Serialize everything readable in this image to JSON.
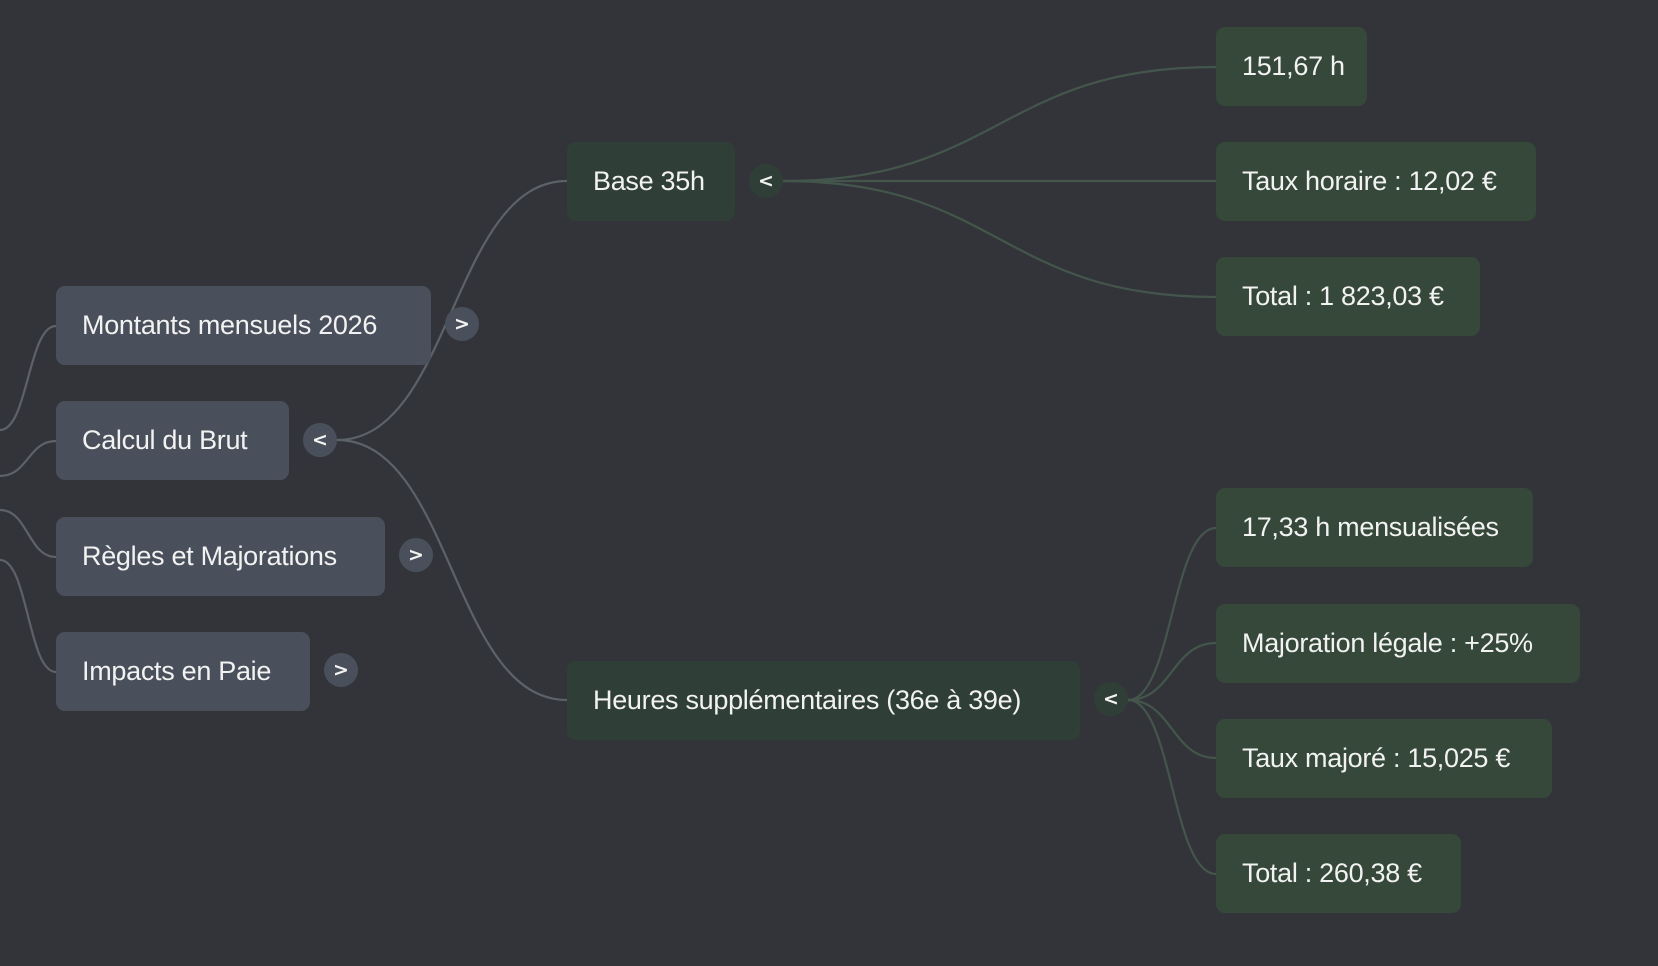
{
  "colors": {
    "background": "#32343a",
    "level1_node": "#4a505b",
    "level2_node": "#2f3f37",
    "level3_node": "#354839",
    "edge_gray": "#5d6269",
    "edge_green": "#44564b",
    "text": "#f2f2f2"
  },
  "toggle_icons": {
    "collapsed": ">",
    "expanded": "<"
  },
  "mindmap": {
    "branches": [
      {
        "label": "Montants mensuels 2026",
        "toggle": ">",
        "state": "collapsed"
      },
      {
        "label": "Calcul du Brut",
        "toggle": "<",
        "state": "expanded",
        "children": [
          {
            "label": "Base 35h",
            "toggle": "<",
            "state": "expanded",
            "children": [
              {
                "label": "151,67 h"
              },
              {
                "label": "Taux horaire : 12,02 €"
              },
              {
                "label": "Total : 1 823,03 €"
              }
            ]
          },
          {
            "label": "Heures supplémentaires (36e à 39e)",
            "toggle": "<",
            "state": "expanded",
            "children": [
              {
                "label": "17,33 h mensualisées"
              },
              {
                "label": "Majoration légale : +25%"
              },
              {
                "label": "Taux majoré : 15,025 €"
              },
              {
                "label": "Total : 260,38 €"
              }
            ]
          }
        ]
      },
      {
        "label": "Règles et Majorations",
        "toggle": ">",
        "state": "collapsed"
      },
      {
        "label": "Impacts en Paie",
        "toggle": ">",
        "state": "collapsed"
      }
    ]
  }
}
